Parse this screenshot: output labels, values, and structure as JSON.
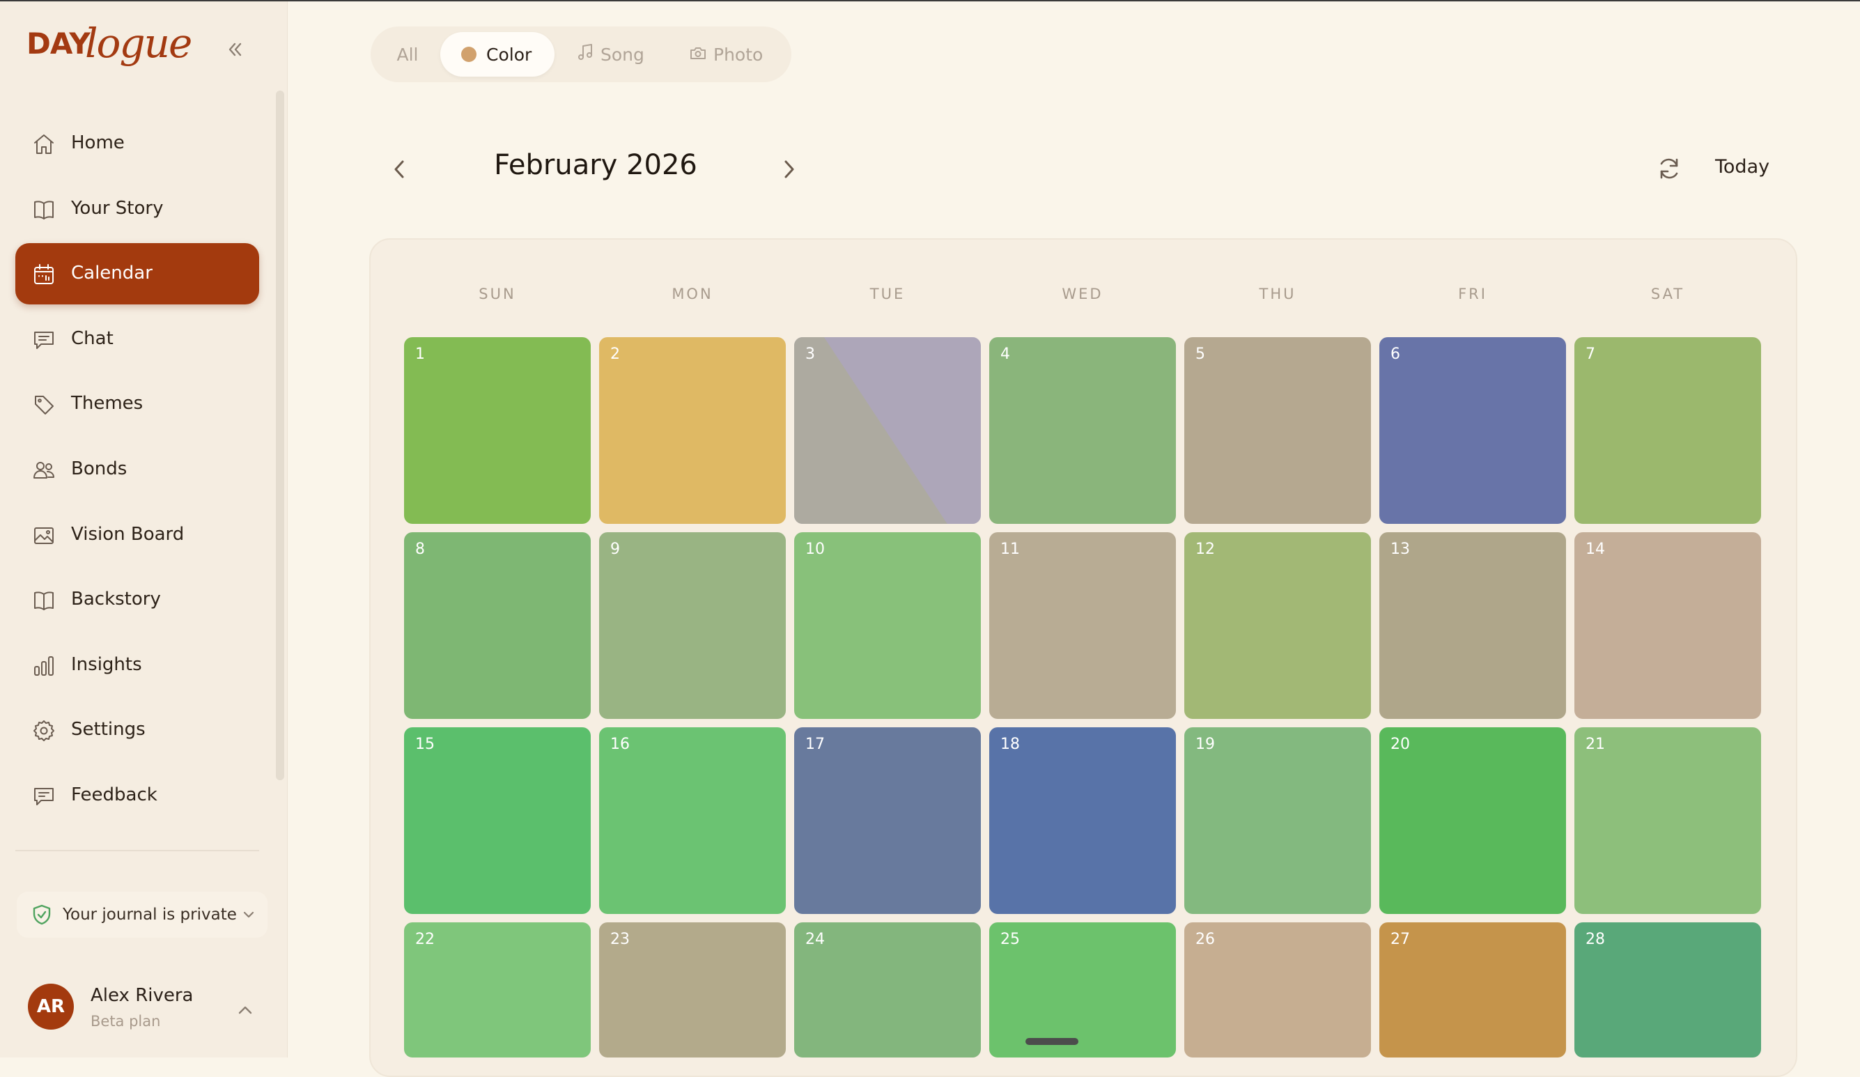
{
  "app": {
    "logo_day": "DAY",
    "logo_logue": "logue",
    "accent": "#a33a0e"
  },
  "sidebar": {
    "items": [
      {
        "label": "Home",
        "icon": "home-icon"
      },
      {
        "label": "Your Story",
        "icon": "book-icon"
      },
      {
        "label": "Calendar",
        "icon": "calendar-icon",
        "active": true
      },
      {
        "label": "Chat",
        "icon": "chat-icon"
      },
      {
        "label": "Themes",
        "icon": "tag-icon"
      },
      {
        "label": "Bonds",
        "icon": "people-icon"
      },
      {
        "label": "Vision Board",
        "icon": "image-icon"
      },
      {
        "label": "Backstory",
        "icon": "book-icon"
      },
      {
        "label": "Insights",
        "icon": "bar-chart-icon"
      },
      {
        "label": "Settings",
        "icon": "gear-icon"
      },
      {
        "label": "Feedback",
        "icon": "feedback-icon"
      }
    ],
    "privacy_text": "Your journal is private",
    "user": {
      "initials": "AR",
      "name": "Alex Rivera",
      "plan": "Beta plan"
    }
  },
  "filters": {
    "all": "All",
    "color": "Color",
    "song": "Song",
    "photo": "Photo",
    "active": "Color"
  },
  "calendar": {
    "month_title": "February 2026",
    "today_label": "Today",
    "weekdays": [
      "SUN",
      "MON",
      "TUE",
      "WED",
      "THU",
      "FRI",
      "SAT"
    ],
    "days": [
      {
        "num": "1",
        "color": "#83bb53"
      },
      {
        "num": "2",
        "color": "#dfb964"
      },
      {
        "num": "3",
        "color": "#ada6b9",
        "split_color": "#adaaa0"
      },
      {
        "num": "4",
        "color": "#8ab57b"
      },
      {
        "num": "5",
        "color": "#b5a890"
      },
      {
        "num": "6",
        "color": "#6874a8"
      },
      {
        "num": "7",
        "color": "#9bb86d"
      },
      {
        "num": "8",
        "color": "#7eb773"
      },
      {
        "num": "9",
        "color": "#99b483"
      },
      {
        "num": "10",
        "color": "#88c17a"
      },
      {
        "num": "11",
        "color": "#b8ac94"
      },
      {
        "num": "12",
        "color": "#a2b875"
      },
      {
        "num": "13",
        "color": "#afa68a"
      },
      {
        "num": "14",
        "color": "#c4ae98"
      },
      {
        "num": "15",
        "color": "#5bbf6c"
      },
      {
        "num": "16",
        "color": "#6bc372"
      },
      {
        "num": "17",
        "color": "#687a9d"
      },
      {
        "num": "18",
        "color": "#5873a8"
      },
      {
        "num": "19",
        "color": "#83b97f"
      },
      {
        "num": "20",
        "color": "#59b95b"
      },
      {
        "num": "21",
        "color": "#8dbf7b"
      },
      {
        "num": "22",
        "color": "#7fc67b"
      },
      {
        "num": "23",
        "color": "#b3aa8b"
      },
      {
        "num": "24",
        "color": "#83b67d"
      },
      {
        "num": "25",
        "color": "#6cc26c"
      },
      {
        "num": "26",
        "color": "#c6ae91"
      },
      {
        "num": "27",
        "color": "#c5944b"
      },
      {
        "num": "28",
        "color": "#59a879"
      }
    ]
  }
}
